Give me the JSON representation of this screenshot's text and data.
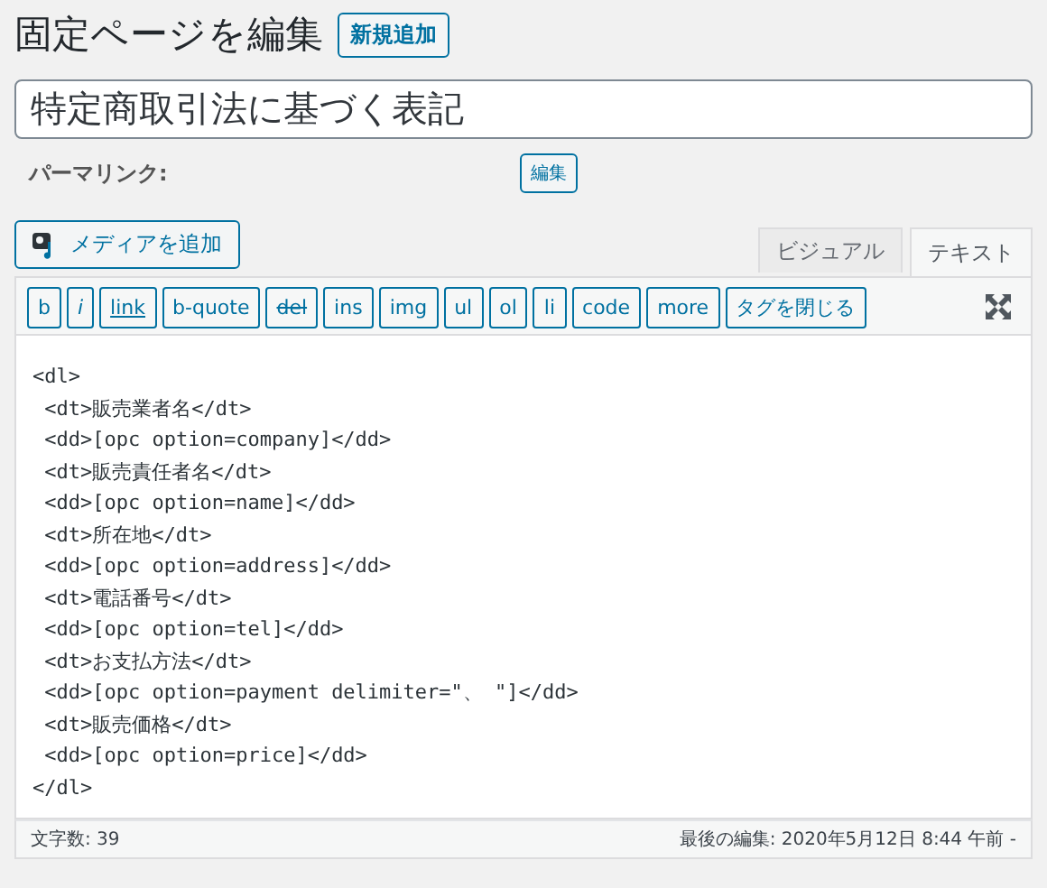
{
  "heading": {
    "title": "固定ページを編集",
    "add_new": "新規追加"
  },
  "post_title": {
    "value": "特定商取引法に基づく表記"
  },
  "permalink": {
    "label": "パーマリンク:",
    "edit": "編集"
  },
  "media_button": "メディアを追加",
  "tabs": [
    {
      "label": "ビジュアル",
      "selected": false
    },
    {
      "label": "テキスト",
      "selected": true
    }
  ],
  "quicktags": [
    {
      "label": "b",
      "kind": "plain"
    },
    {
      "label": "i",
      "kind": "italic"
    },
    {
      "label": "link",
      "kind": "link"
    },
    {
      "label": "b-quote",
      "kind": "plain"
    },
    {
      "label": "del",
      "kind": "strike"
    },
    {
      "label": "ins",
      "kind": "plain"
    },
    {
      "label": "img",
      "kind": "plain"
    },
    {
      "label": "ul",
      "kind": "plain"
    },
    {
      "label": "ol",
      "kind": "plain"
    },
    {
      "label": "li",
      "kind": "plain"
    },
    {
      "label": "code",
      "kind": "plain"
    },
    {
      "label": "more",
      "kind": "plain"
    },
    {
      "label": "タグを閉じる",
      "kind": "plain"
    }
  ],
  "editor": {
    "lines": [
      "<dl>",
      " <dt>販売業者名</dt>",
      " <dd>[opc option=company]</dd>",
      " <dt>販売責任者名</dt>",
      " <dd>[opc option=name]</dd>",
      " <dt>所在地</dt>",
      " <dd>[opc option=address]</dd>",
      " <dt>電話番号</dt>",
      " <dd>[opc option=tel]</dd>",
      " <dt>お支払方法</dt>",
      " <dd>[opc option=payment delimiter=\"、 \"]</dd>",
      " <dt>販売価格</dt>",
      " <dd>[opc option=price]</dd>",
      "</dl>"
    ]
  },
  "status_bar": {
    "word_count": "文字数: 39",
    "last_edited": "最後の編集: 2020年5月12日 8:44 午前 -"
  }
}
